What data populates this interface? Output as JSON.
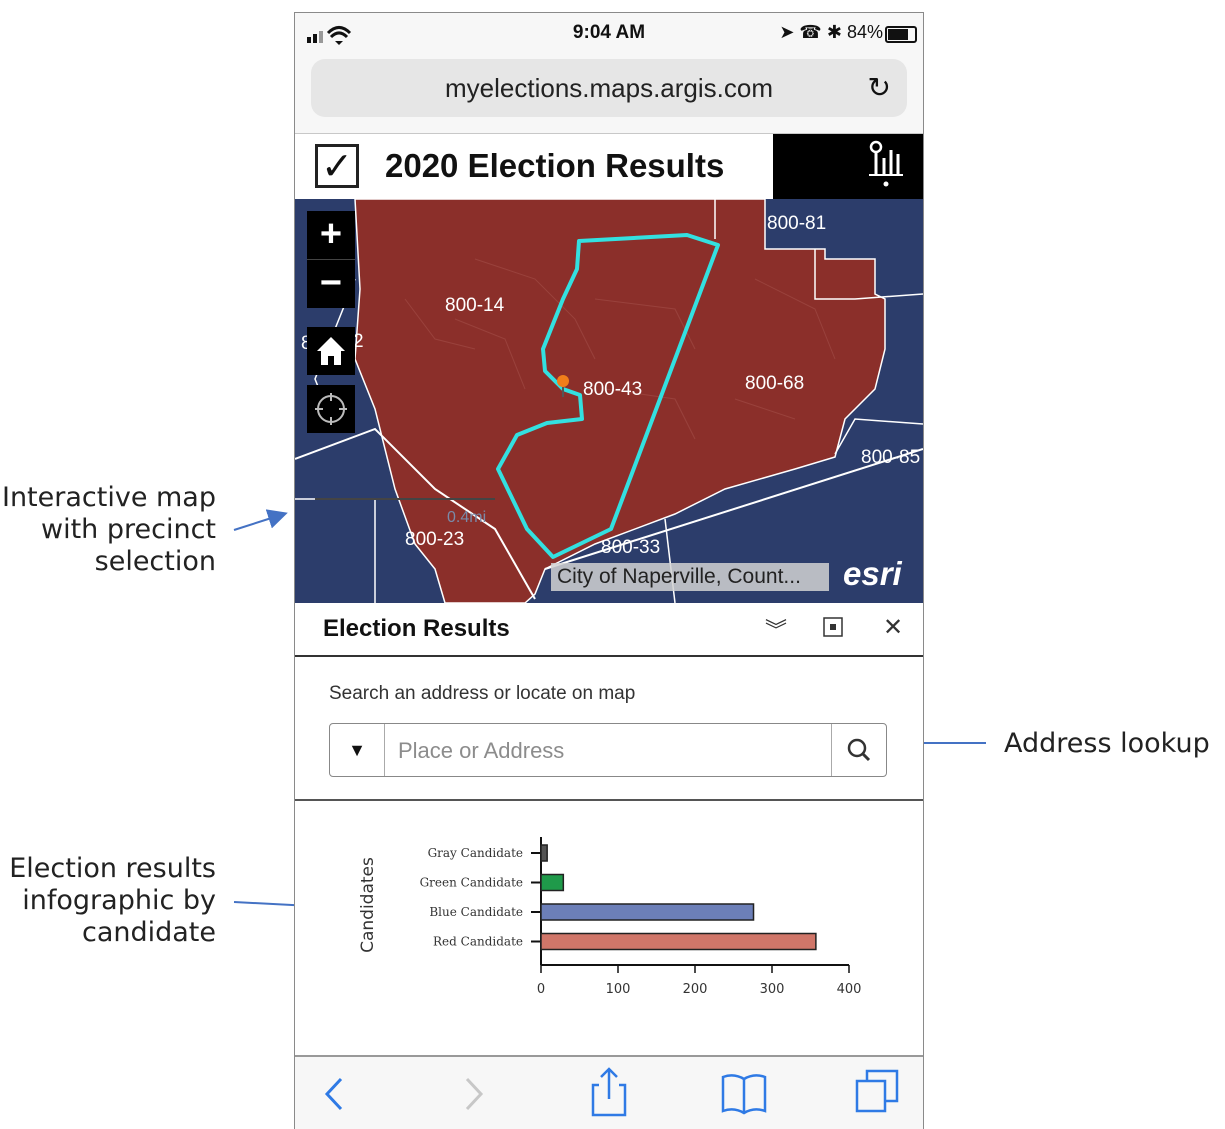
{
  "annotations": [
    {
      "id": "map",
      "lines": [
        "Interactive map",
        "with precinct",
        "selection"
      ]
    },
    {
      "id": "address",
      "lines": [
        "Address lookup"
      ]
    },
    {
      "id": "chart",
      "lines": [
        "Election results",
        "infographic by",
        "candidate"
      ]
    }
  ],
  "status_bar": {
    "time": "9:04 AM",
    "battery": "84%",
    "battery_level": 0.84
  },
  "browser": {
    "url": "myelections.maps.argis.com",
    "reload_icon": "reload-icon"
  },
  "app": {
    "title": "2020 Election Results",
    "checkbox_icon": "check-icon",
    "toolbar_icon": "location-chart-icon"
  },
  "map": {
    "precincts": [
      "800-81",
      "800-14",
      "8",
      "2",
      "800-43",
      "800-68",
      "800-85",
      "800-23",
      "800-33"
    ],
    "scale": "0.4mi",
    "attribution": "City of Naperville, Count...",
    "logo": "esri",
    "colors": {
      "background": "#2c3d6b",
      "precinct_red": "#8b2f2a",
      "selection": "#33e0e0",
      "roads": "#ffffff"
    },
    "controls": {
      "zoom_in": "+",
      "zoom_out": "−",
      "home_icon": "home-icon",
      "locate_icon": "locate-icon"
    }
  },
  "panel": {
    "title": "Election Results",
    "icons": [
      "collapse-icon",
      "maximize-icon",
      "close-icon"
    ],
    "search_label": "Search an address or locate on map",
    "search_placeholder": "Place or Address"
  },
  "chart_data": {
    "type": "bar",
    "orientation": "horizontal",
    "categories": [
      "Gray Candidate",
      "Green Candidate",
      "Blue Candidate",
      "Red Candidate"
    ],
    "values": [
      8,
      29,
      276,
      357
    ],
    "colors": [
      "#555555",
      "#1f9a4a",
      "#6c7fb8",
      "#d07669"
    ],
    "title": "",
    "xlabel": "",
    "ylabel": "Candidates",
    "xlim": [
      0,
      400
    ],
    "xticks": [
      0,
      100,
      200,
      300,
      400
    ],
    "grid": false
  },
  "tab_bar": {
    "icons": [
      "back-icon",
      "forward-icon",
      "share-icon",
      "bookmarks-icon",
      "tabs-icon"
    ]
  }
}
